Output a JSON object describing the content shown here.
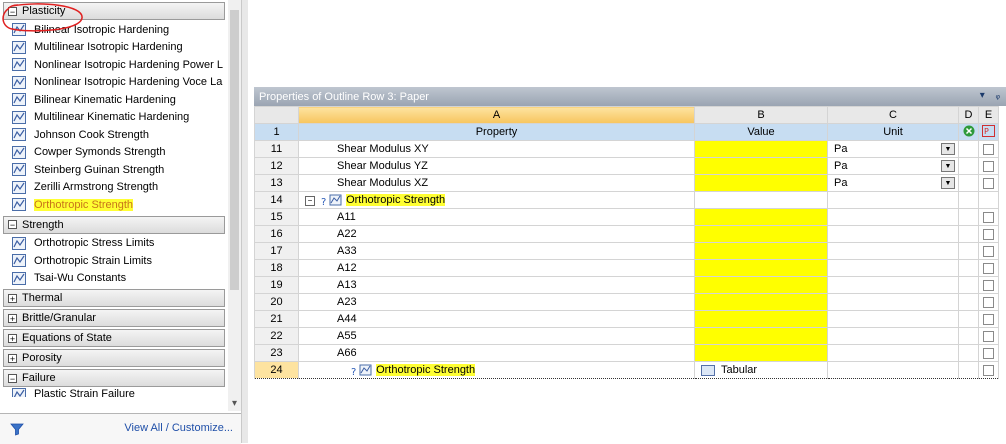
{
  "toolbox": {
    "sections": [
      {
        "label": "Plasticity",
        "expanded": true,
        "items": [
          "Bilinear Isotropic Hardening",
          "Multilinear Isotropic Hardening",
          "Nonlinear Isotropic Hardening Power L",
          "Nonlinear Isotropic Hardening Voce La",
          "Bilinear Kinematic Hardening",
          "Multilinear Kinematic Hardening",
          "Johnson Cook Strength",
          "Cowper Symonds Strength",
          "Steinberg Guinan Strength",
          "Zerilli Armstrong Strength",
          "Orthotropic Strength"
        ]
      },
      {
        "label": "Strength",
        "expanded": true,
        "items": [
          "Orthotropic Stress Limits",
          "Orthotropic Strain Limits",
          "Tsai-Wu Constants"
        ]
      },
      {
        "label": "Thermal",
        "expanded": false,
        "items": []
      },
      {
        "label": "Brittle/Granular",
        "expanded": false,
        "items": []
      },
      {
        "label": "Equations of State",
        "expanded": false,
        "items": []
      },
      {
        "label": "Porosity",
        "expanded": false,
        "items": []
      },
      {
        "label": "Failure",
        "expanded": true,
        "items": [
          "Plastic Strain Failure"
        ]
      }
    ],
    "footer_link": "View All / Customize..."
  },
  "properties": {
    "title": "Properties of Outline Row 3: Paper",
    "col_letters": [
      "A",
      "B",
      "C",
      "D",
      "E"
    ],
    "col_headers": [
      "Property",
      "Value",
      "Unit"
    ],
    "header_row_num": "1",
    "rows": [
      {
        "num": "11",
        "property": "Shear Modulus XY",
        "unit": "Pa"
      },
      {
        "num": "12",
        "property": "Shear Modulus YZ",
        "unit": "Pa"
      },
      {
        "num": "13",
        "property": "Shear Modulus XZ",
        "unit": "Pa"
      },
      {
        "num": "14",
        "property": "Orthotropic Strength",
        "group": true
      },
      {
        "num": "15",
        "property": "A11"
      },
      {
        "num": "16",
        "property": "A22"
      },
      {
        "num": "17",
        "property": "A33"
      },
      {
        "num": "18",
        "property": "A12"
      },
      {
        "num": "19",
        "property": "A13"
      },
      {
        "num": "20",
        "property": "A23"
      },
      {
        "num": "21",
        "property": "A44"
      },
      {
        "num": "22",
        "property": "A55"
      },
      {
        "num": "23",
        "property": "A66"
      },
      {
        "num": "24",
        "property": "Orthotropic Strength",
        "value": "Tabular",
        "selected": true
      }
    ]
  },
  "colors": {
    "highlight": "#ffff33",
    "value_cell": "#ffff00",
    "annotation": "#e02020"
  }
}
